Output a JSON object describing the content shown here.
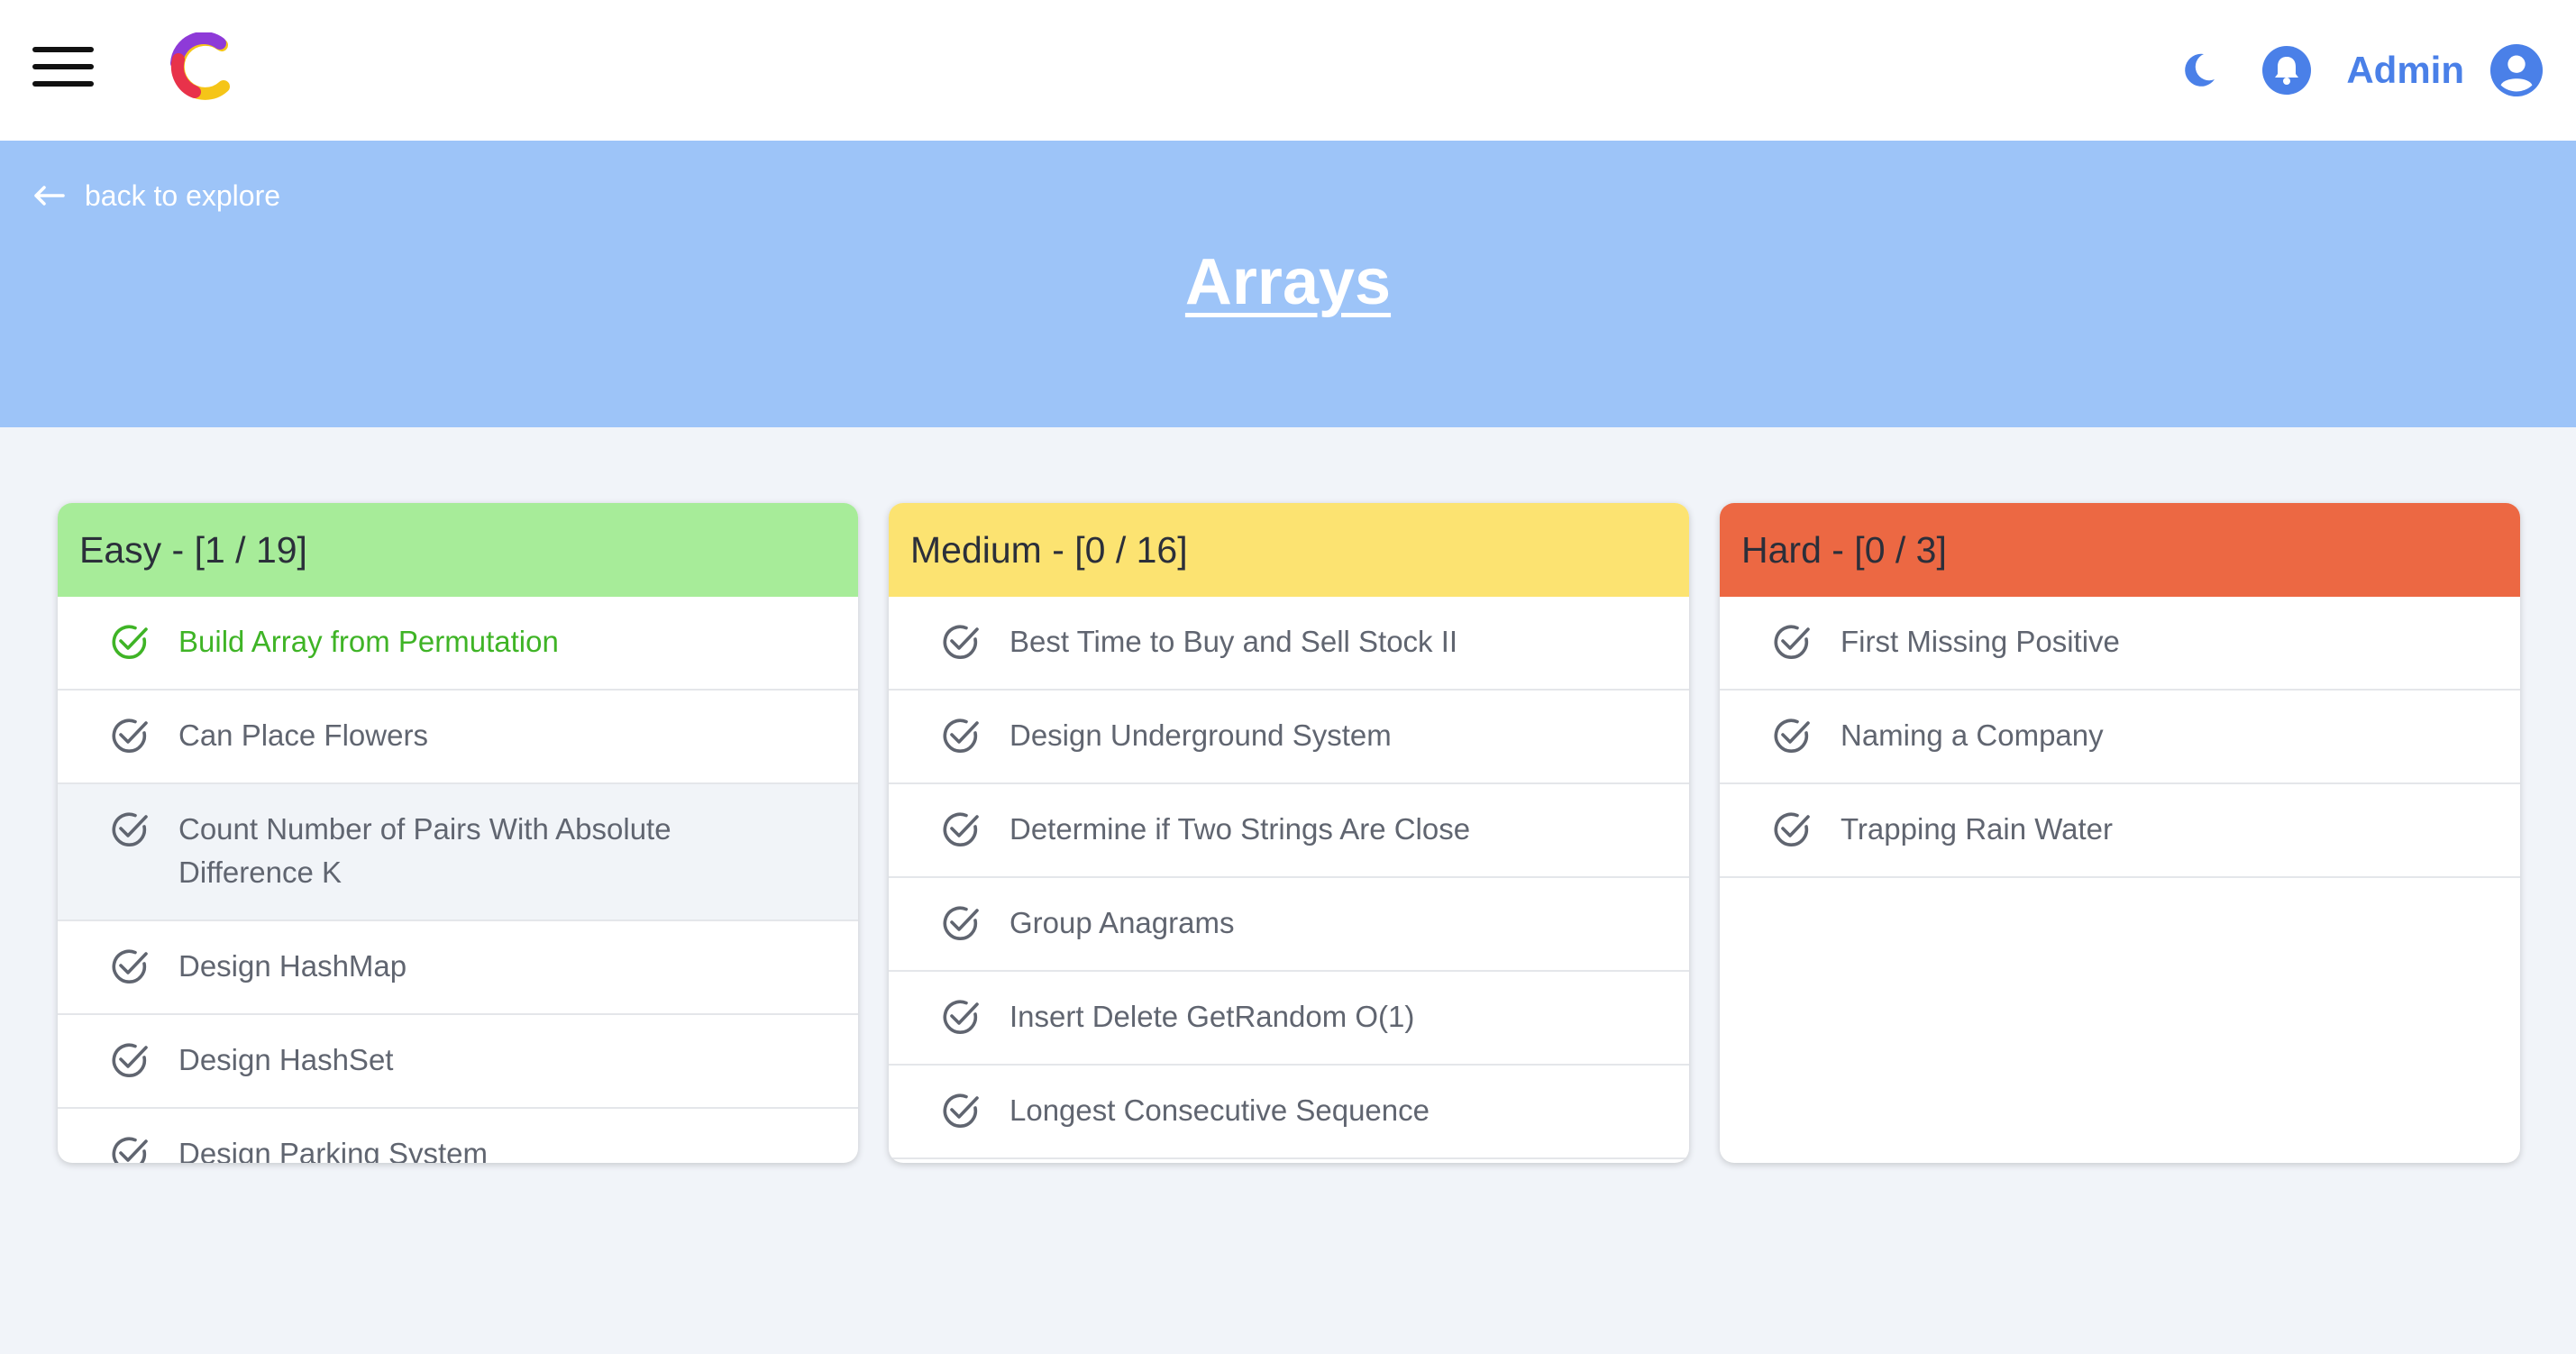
{
  "nav": {
    "admin_label": "Admin",
    "icons": [
      "menu-icon",
      "logo-icon",
      "moon-icon",
      "bell-icon",
      "user-avatar-icon"
    ],
    "accent_color": "#4a80e8"
  },
  "banner": {
    "back_label": "back to explore",
    "title": "Arrays",
    "background": "#9dc4f8"
  },
  "columns": {
    "easy": {
      "title": "Easy - [1 / 19]",
      "color": "#a7ec99",
      "items": [
        {
          "label": "Build Array from Permutation",
          "completed": true
        },
        {
          "label": "Can Place Flowers",
          "completed": false
        },
        {
          "label": "Count Number of Pairs With Absolute Difference K",
          "completed": false
        },
        {
          "label": "Design HashMap",
          "completed": false
        },
        {
          "label": "Design HashSet",
          "completed": false
        },
        {
          "label": "Design Parking System",
          "completed": false
        }
      ]
    },
    "medium": {
      "title": "Medium - [0 / 16]",
      "color": "#fce371",
      "items": [
        {
          "label": "Best Time to Buy and Sell Stock II",
          "completed": false
        },
        {
          "label": "Design Underground System",
          "completed": false
        },
        {
          "label": "Determine if Two Strings Are Close",
          "completed": false
        },
        {
          "label": "Group Anagrams",
          "completed": false
        },
        {
          "label": "Insert Delete GetRandom O(1)",
          "completed": false
        },
        {
          "label": "Longest Consecutive Sequence",
          "completed": false
        }
      ]
    },
    "hard": {
      "title": "Hard - [0 / 3]",
      "color": "#ec6843",
      "items": [
        {
          "label": "First Missing Positive",
          "completed": false
        },
        {
          "label": "Naming a Company",
          "completed": false
        },
        {
          "label": "Trapping Rain Water",
          "completed": false
        }
      ]
    }
  },
  "status_colors": {
    "completed": "#3fb426",
    "pending": "#606570"
  }
}
